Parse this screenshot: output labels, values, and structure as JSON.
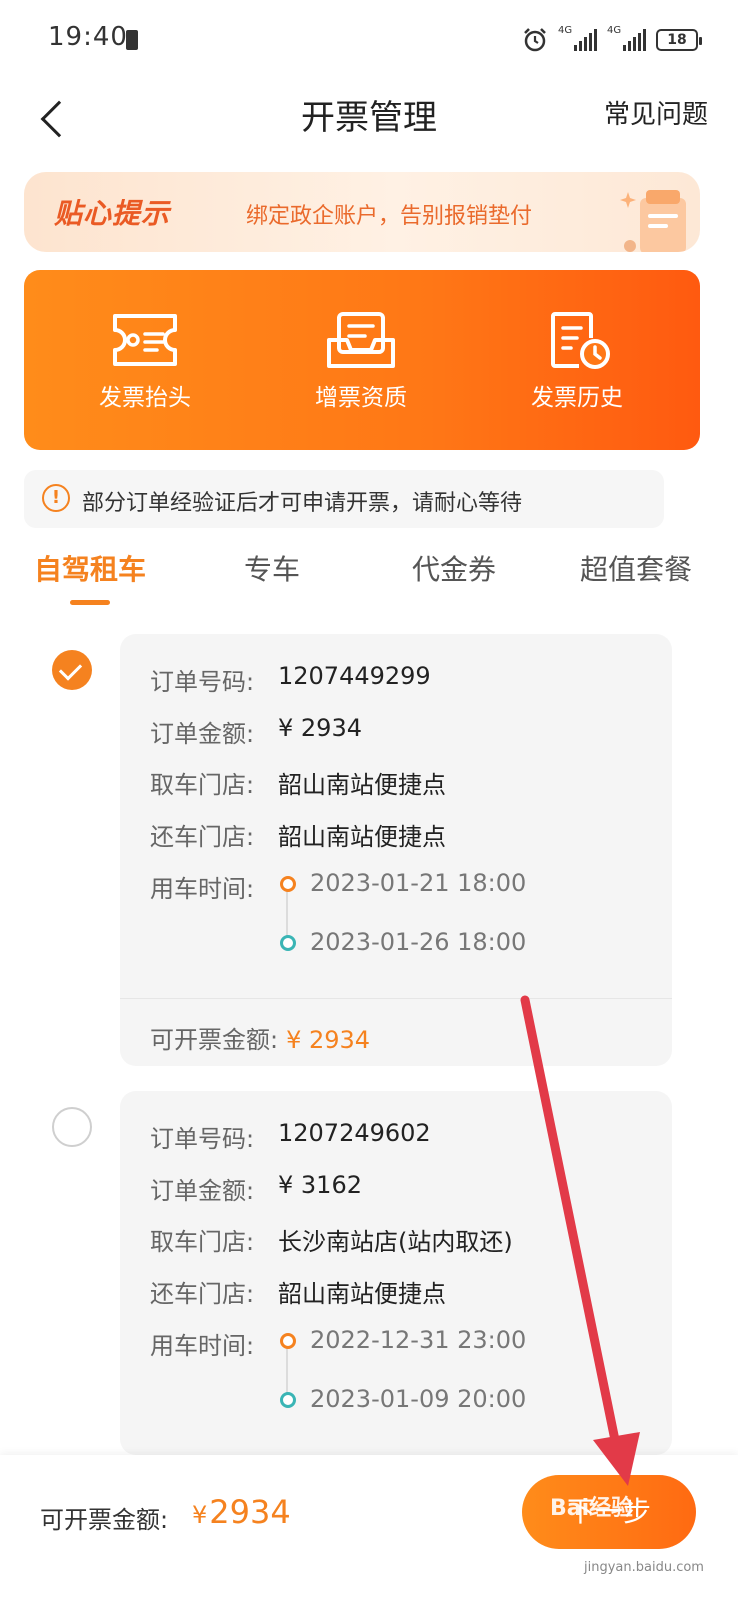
{
  "status_bar": {
    "time": "19:40",
    "network_1": "4G",
    "network_2": "4G",
    "battery": "18"
  },
  "header": {
    "title": "开票管理",
    "faq": "常见问题"
  },
  "tip_banner": {
    "title": "贴心提示",
    "text": "绑定政企账户，告别报销垫付"
  },
  "quick_actions": [
    {
      "label": "发票抬头",
      "icon": "ticket-card-icon"
    },
    {
      "label": "增票资质",
      "icon": "document-tray-icon"
    },
    {
      "label": "发票历史",
      "icon": "document-clock-icon"
    }
  ],
  "notice": {
    "icon": "!",
    "text": "部分订单经验证后才可申请开票，请耐心等待"
  },
  "tabs": [
    {
      "label": "自驾租车",
      "active": true
    },
    {
      "label": "专车",
      "active": false
    },
    {
      "label": "代金券",
      "active": false
    },
    {
      "label": "超值套餐",
      "active": false
    }
  ],
  "field_labels": {
    "order_no": "订单号码:",
    "amount": "订单金额:",
    "pickup": "取车门店:",
    "return": "还车门店:",
    "time": "用车时间:",
    "invoiceable": "可开票金额:"
  },
  "orders": [
    {
      "selected": true,
      "order_no": "1207449299",
      "amount": "¥ 2934",
      "pickup_store": "韶山南站便捷点",
      "return_store": "韶山南站便捷点",
      "start_time": "2023-01-21 18:00",
      "end_time": "2023-01-26 18:00",
      "invoiceable_amount": "¥ 2934"
    },
    {
      "selected": false,
      "order_no": "1207249602",
      "amount": "¥ 3162",
      "pickup_store": "长沙南站店(站内取还)",
      "return_store": "韶山南站便捷点",
      "start_time": "2022-12-31 23:00",
      "end_time": "2023-01-09 20:00"
    }
  ],
  "bottom_bar": {
    "label": "可开票金额:",
    "currency": "¥",
    "amount": "2934",
    "next_button": "下一步"
  },
  "watermark": {
    "text": "Bai经验",
    "sub": "jingyan.baidu.com"
  },
  "colors": {
    "accent": "#f5821f",
    "panel_start": "#ff8c1a",
    "panel_end": "#ff5a10",
    "teal": "#3ab5b5",
    "annotation_arrow": "#e23a48"
  }
}
